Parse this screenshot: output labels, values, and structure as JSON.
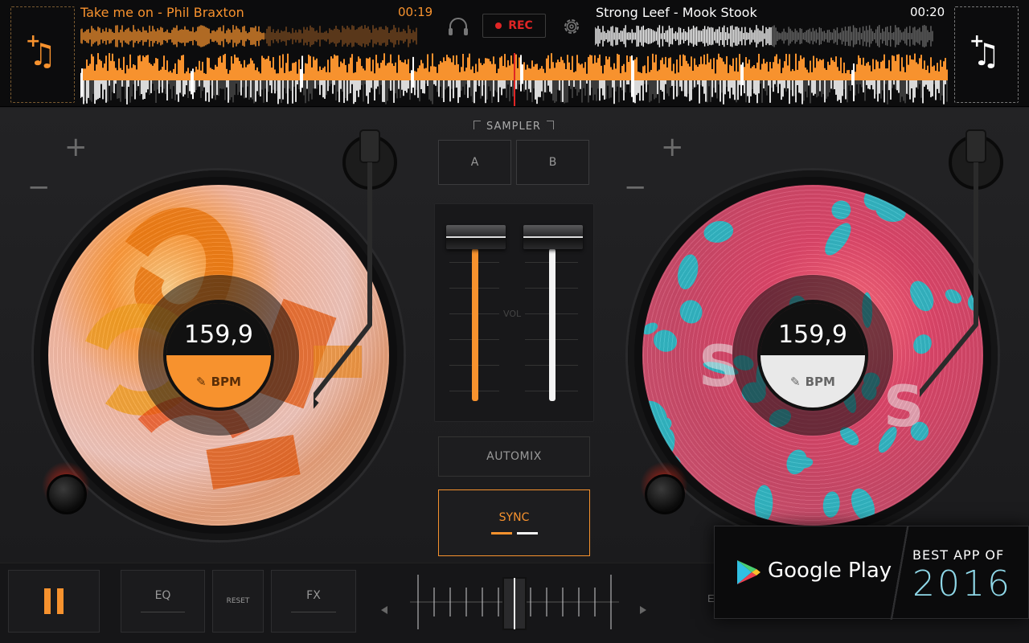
{
  "colors": {
    "deckA": "#f7922e",
    "deckB": "#ffffff",
    "rec": "#e02525",
    "accent_badge": "#8fd8e8"
  },
  "deckA": {
    "track_title": "Take me on - Phil Braxton",
    "time": "00:19",
    "bpm": "159,9",
    "bpm_label": "BPM",
    "load_icon": "add-music-icon",
    "plus_label": "+",
    "minus_label": "−"
  },
  "deckB": {
    "track_title": "Strong Leef - Mook Stook",
    "time": "00:20",
    "bpm": "159,9",
    "bpm_label": "BPM",
    "load_icon": "add-music-icon",
    "plus_label": "+",
    "minus_label": "−"
  },
  "topbar": {
    "rec_label": "REC",
    "headphones_icon": "headphones-icon",
    "settings_icon": "gear-icon"
  },
  "mixer": {
    "sampler_label": "SAMPLER",
    "pad_a": "A",
    "pad_b": "B",
    "vol_label": "VOL",
    "automix_label": "AUTOMIX",
    "sync_label": "SYNC"
  },
  "bottombar": {
    "pause_icon": "pause-icon",
    "eq_label": "EQ",
    "reset_label": "RESET",
    "fx_label": "FX",
    "partial_label": "E"
  },
  "badge": {
    "store_name": "Google Play",
    "award_line": "BEST APP OF",
    "award_year": "2016"
  }
}
